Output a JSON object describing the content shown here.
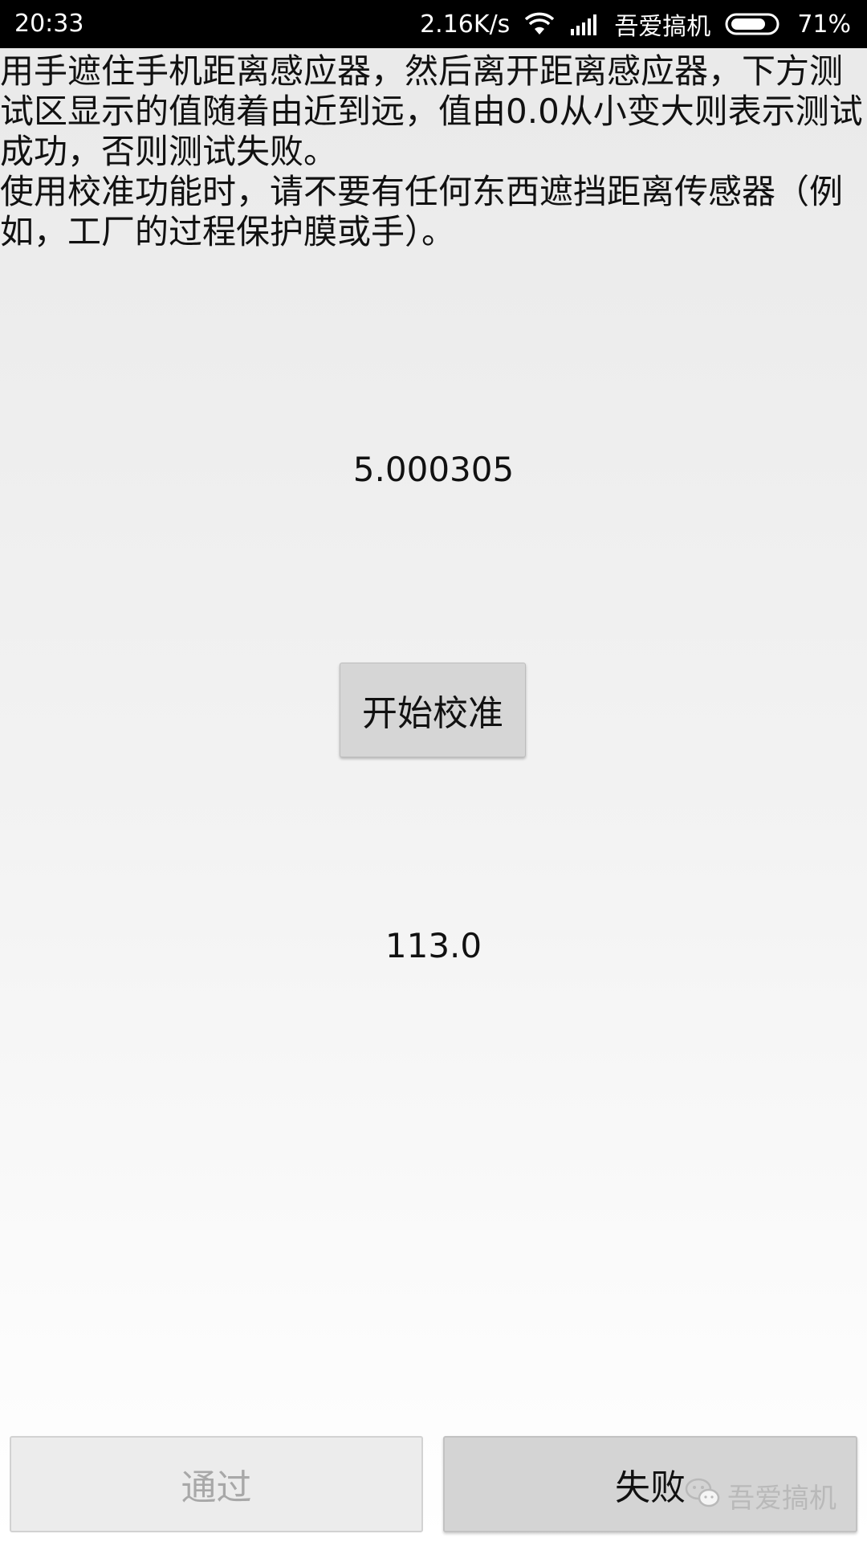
{
  "status_bar": {
    "time": "20:33",
    "net_speed": "2.16K/s",
    "carrier": "吾爱搞机",
    "battery": "71%",
    "icons": [
      "wifi-icon",
      "signal-icon",
      "battery-icon"
    ]
  },
  "instructions": {
    "line1": "用手遮住手机距离感应器，然后离开距离感应器，下方测试区显示的值随着由近到远，值由0.0从小变大则表示测试成功，否则测试失败。",
    "line2": "使用校准功能时，请不要有任何东西遮挡距离传感器（例如，工厂的过程保护膜或手）。"
  },
  "sensor": {
    "calibration_value": "5.000305",
    "distance_value": "113.0"
  },
  "buttons": {
    "calibrate": "开始校准",
    "pass": "通过",
    "fail": "失败"
  },
  "watermark": {
    "text": "吾爱搞机",
    "icon": "wechat-icon"
  }
}
